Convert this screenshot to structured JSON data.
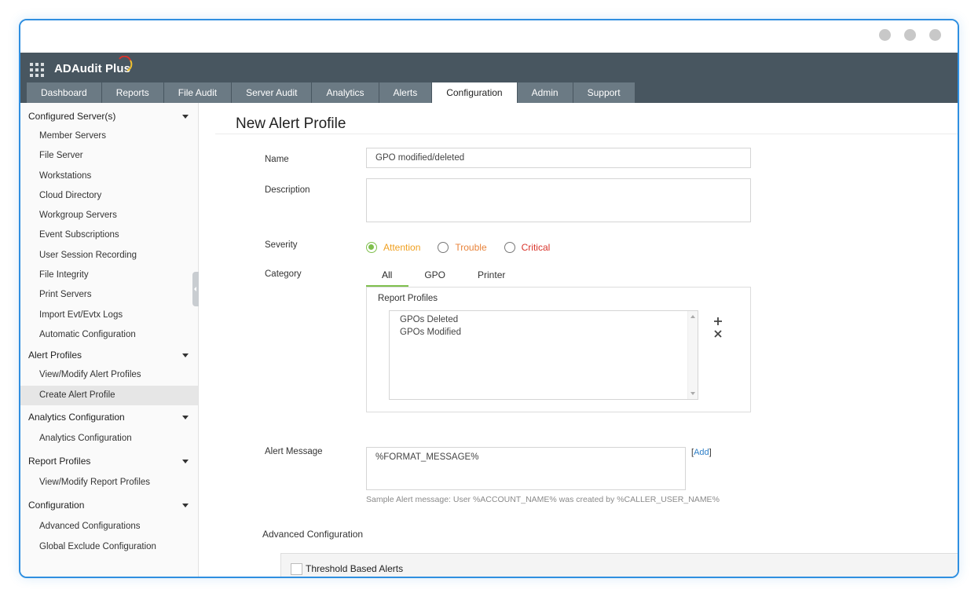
{
  "app": {
    "name": "ADAudit Plus"
  },
  "window_controls": [
    "dot",
    "dot",
    "dot"
  ],
  "tabs": [
    {
      "label": "Dashboard"
    },
    {
      "label": "Reports"
    },
    {
      "label": "File Audit"
    },
    {
      "label": "Server Audit"
    },
    {
      "label": "Analytics"
    },
    {
      "label": "Alerts"
    },
    {
      "label": "Configuration"
    },
    {
      "label": "Admin"
    },
    {
      "label": "Support"
    }
  ],
  "active_tab": "Configuration",
  "sidebar": {
    "sections": [
      {
        "title": "Configured Server(s)",
        "items": [
          "Member Servers",
          "File Server",
          "Workstations",
          "Cloud Directory",
          "Workgroup Servers",
          "Event Subscriptions",
          "User Session Recording",
          "File Integrity",
          "Print Servers",
          "Import Evt/Evtx Logs",
          "Automatic Configuration"
        ]
      },
      {
        "title": "Alert Profiles",
        "items": [
          "View/Modify Alert Profiles",
          "Create Alert Profile"
        ]
      },
      {
        "title": "Analytics Configuration",
        "items": [
          "Analytics Configuration"
        ]
      },
      {
        "title": "Report Profiles",
        "items": [
          "View/Modify Report Profiles"
        ]
      },
      {
        "title": "Configuration",
        "items": [
          "Advanced Configurations",
          "Global Exclude Configuration"
        ]
      }
    ],
    "active_item": "Create Alert Profile"
  },
  "form": {
    "title": "New Alert Profile",
    "name_label": "Name",
    "name_value": "GPO modified/deleted",
    "description_label": "Description",
    "description_value": "",
    "severity_label": "Severity",
    "severity_options": [
      {
        "label": "Attention",
        "color": "#f0a020",
        "checked": true
      },
      {
        "label": "Trouble",
        "color": "#e8833a",
        "checked": false
      },
      {
        "label": "Critical",
        "color": "#d9342b",
        "checked": false
      }
    ],
    "category_label": "Category",
    "category_tabs": [
      "All",
      "GPO",
      "Printer"
    ],
    "active_category": "All",
    "report_profiles_label": "Report Profiles",
    "report_profiles": [
      "GPOs Deleted",
      "GPOs Modified"
    ],
    "add_icon": "plus-icon",
    "remove_icon": "close-icon",
    "alert_message_label": "Alert Message",
    "alert_message_value": "%FORMAT_MESSAGE%",
    "add_link_prefix": "[",
    "add_link": "Add",
    "add_link_suffix": "]",
    "sample_message": "Sample Alert message: User %ACCOUNT_NAME% was created by %CALLER_USER_NAME%",
    "advanced_label": "Advanced Configuration",
    "threshold_label": "Threshold Based Alerts"
  },
  "colors": {
    "header_bg": "#485660",
    "tab_bg": "#6b7a84",
    "accent_green": "#7fbf4d",
    "frame_border": "#2f8fe0",
    "link": "#2d7fc8"
  }
}
